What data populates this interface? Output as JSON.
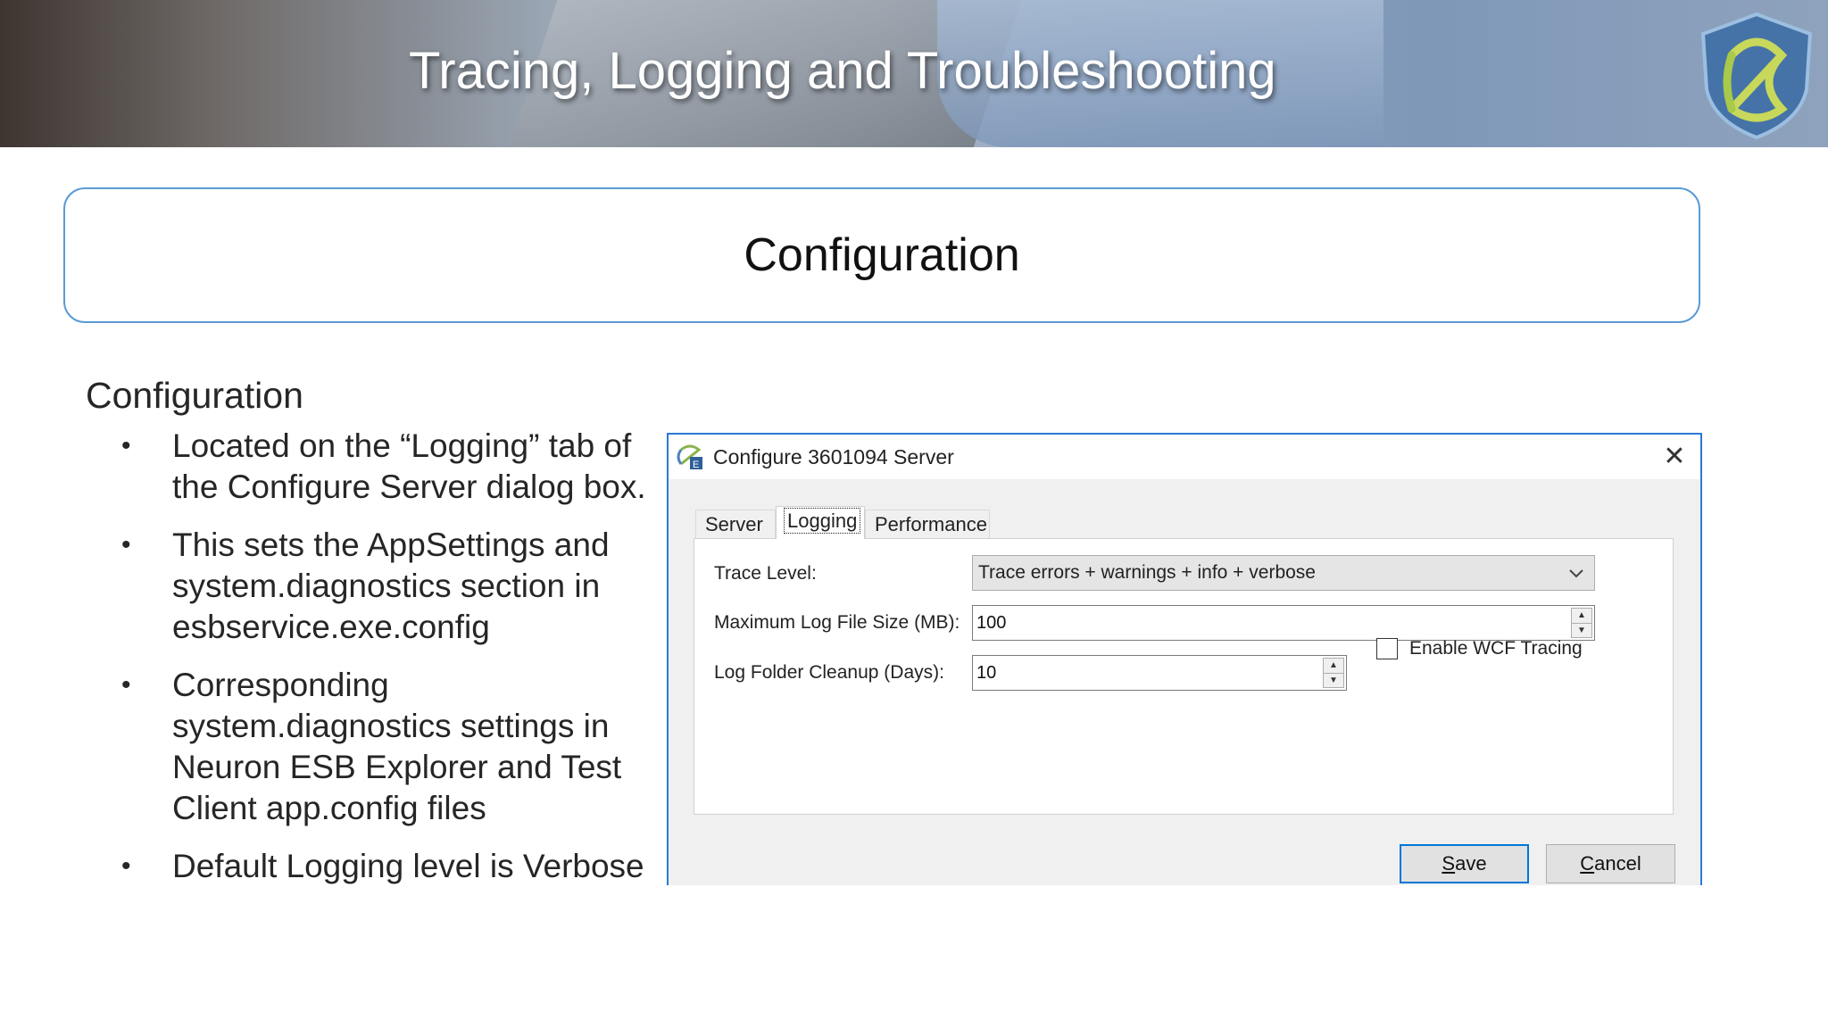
{
  "banner": {
    "title": "Tracing, Logging and Troubleshooting"
  },
  "header": {
    "title": "Configuration"
  },
  "content": {
    "section_title": "Configuration",
    "bullets": [
      "Located on the “Logging” tab of the Configure Server dialog box.",
      "This sets the AppSettings and system.diagnostics section in esbservice.exe.config",
      "Corresponding system.diagnostics settings in Neuron ESB Explorer and Test Client app.config files",
      "Default Logging level is Verbose"
    ],
    "bullet_glyph": "•"
  },
  "dialog": {
    "title": "Configure 3601094 Server",
    "close_glyph": "✕",
    "tabs": [
      {
        "label": "Server",
        "active": false
      },
      {
        "label": "Logging",
        "active": true
      },
      {
        "label": "Performance",
        "active": false
      }
    ],
    "trace_level": {
      "label": "Trace Level:",
      "value": "Trace errors + warnings + info + verbose"
    },
    "max_log_size": {
      "label": "Maximum Log File Size (MB):",
      "value": "100"
    },
    "cleanup_days": {
      "label": "Log Folder Cleanup (Days):",
      "value": "10"
    },
    "wcf_tracing": {
      "label": "Enable WCF Tracing",
      "checked": false
    },
    "buttons": {
      "save_mnemonic": "S",
      "save_rest": "ave",
      "cancel_mnemonic": "C",
      "cancel_rest": "ancel"
    }
  },
  "colors": {
    "accent": "#5b9bd5",
    "dialog_border": "#2b79d6",
    "primary_button_border": "#0078d7"
  },
  "icons": {
    "logo": "shield-knot-logo-icon",
    "app_icon": "server-config-icon",
    "close": "close-icon",
    "dropdown": "chevron-down-icon",
    "spin_up": "spin-up-icon",
    "spin_down": "spin-down-icon"
  }
}
